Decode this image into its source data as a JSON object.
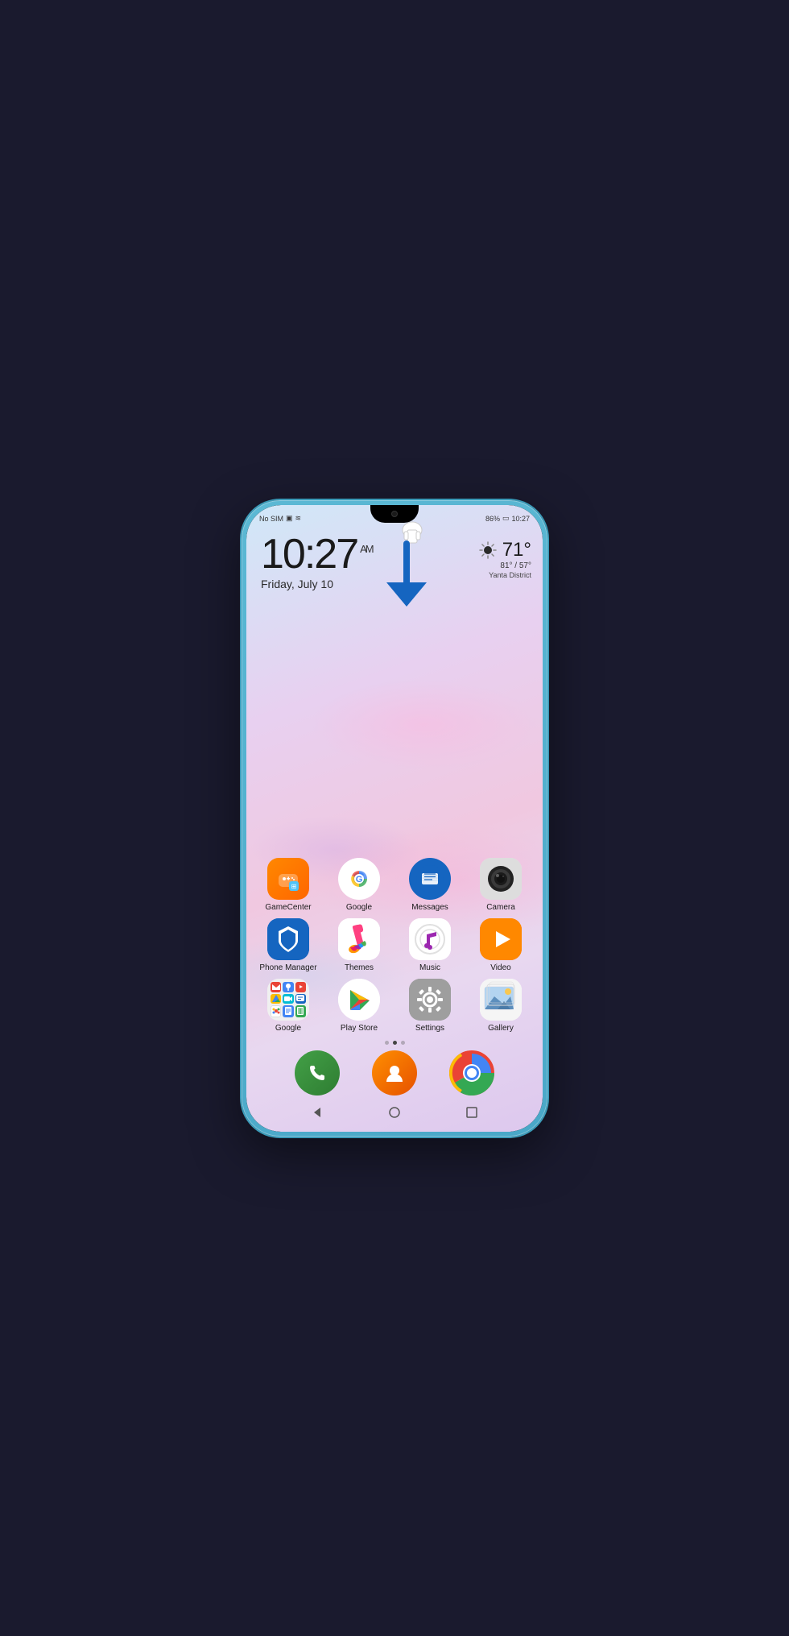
{
  "status": {
    "left": "No SIM",
    "battery": "86%",
    "time": "10:27"
  },
  "clock": {
    "time": "10:27",
    "ampm": "AM",
    "date": "Friday, July 10"
  },
  "weather": {
    "location": "Yanta District",
    "temp": "71°",
    "high": "81°",
    "low": "57°"
  },
  "apps_row1": [
    {
      "id": "gamecenter",
      "label": "GameCenter"
    },
    {
      "id": "google",
      "label": "Google"
    },
    {
      "id": "messages",
      "label": "Messages"
    },
    {
      "id": "camera",
      "label": "Camera"
    }
  ],
  "apps_row2": [
    {
      "id": "phonemanager",
      "label": "Phone Manager"
    },
    {
      "id": "themes",
      "label": "Themes"
    },
    {
      "id": "music",
      "label": "Music"
    },
    {
      "id": "video",
      "label": "Video"
    }
  ],
  "apps_row3": [
    {
      "id": "googlefolder",
      "label": "Google"
    },
    {
      "id": "playstore",
      "label": "Play Store"
    },
    {
      "id": "settings",
      "label": "Settings"
    },
    {
      "id": "gallery",
      "label": "Gallery"
    }
  ],
  "dock": [
    {
      "id": "phone",
      "label": "Phone"
    },
    {
      "id": "contacts",
      "label": "Contacts"
    },
    {
      "id": "chrome",
      "label": "Chrome"
    }
  ],
  "nav": {
    "back": "◁",
    "home": "○",
    "recent": "□"
  }
}
